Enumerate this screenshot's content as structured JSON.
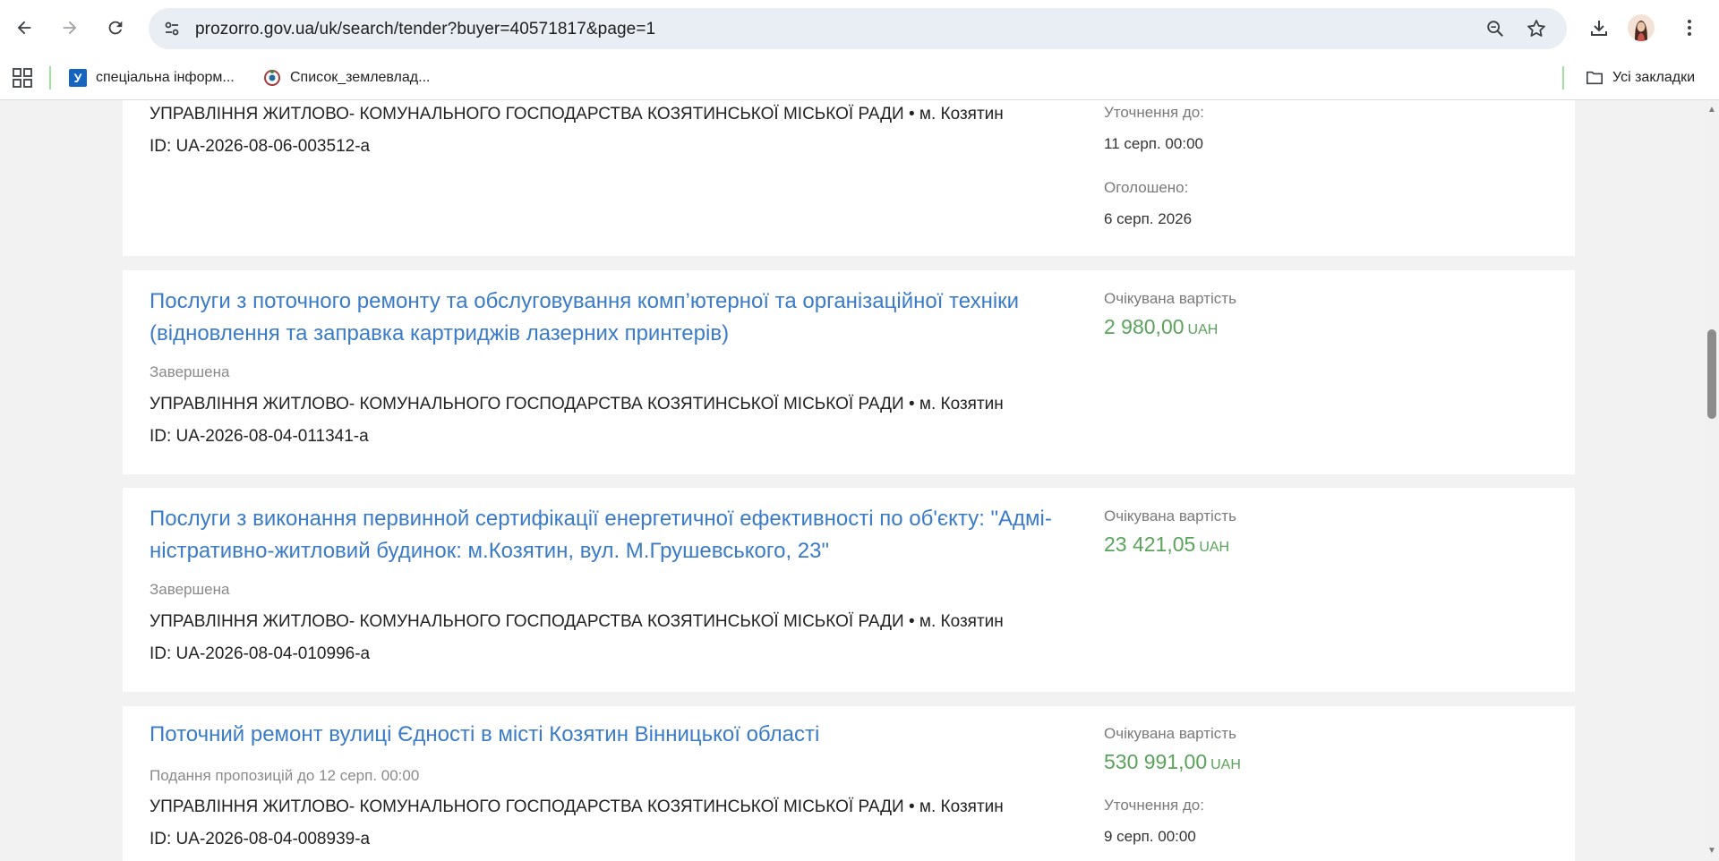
{
  "browser": {
    "url": "prozorro.gov.ua/uk/search/tender?buyer=40571817&page=1",
    "bookmarks": [
      {
        "label": "спеціальна інформ...",
        "icon": "u-favicon-icon",
        "favicon_text": "У"
      },
      {
        "label": "Список_землевлад...",
        "icon": "wikimedia-favicon-icon"
      }
    ],
    "all_bookmarks_label": "Усі закладки"
  },
  "tenders": [
    {
      "buyer": "УПРАВЛІННЯ ЖИТЛОВО- КОМУНАЛЬНОГО ГОСПОДАРСТВА КОЗЯТИНСЬКОЇ МІСЬКОЇ РАДИ • м. Козятин",
      "id": "ID: UA-2026-08-06-003512-a",
      "side": [
        {
          "label": "Уточнення до:",
          "value": "11 серп. 00:00"
        },
        {
          "label": "Оголошено:",
          "value": "6 серп. 2026"
        }
      ]
    },
    {
      "title": "Послуги з поточного ремонту та обслуговування комп’ютерної та організаційної техніки (відновлення та заправка картриджів лазерних принтерів)",
      "status": "Завершена",
      "buyer": "УПРАВЛІННЯ ЖИТЛОВО- КОМУНАЛЬНОГО ГОСПОДАРСТВА КОЗЯТИНСЬКОЇ МІСЬКОЇ РАДИ • м. Козятин",
      "id": "ID: UA-2026-08-04-011341-a",
      "price_label": "Очікувана вартість",
      "price": "2 980,00",
      "currency": "UAH"
    },
    {
      "title": "Послуги з виконання первинной сертифікації енергетичної ефективності по об'єкту: \"Адмі-ністративно-житловий будинок: м.Козятин, вул. М.Грушевського, 23\"",
      "status": "Завершена",
      "buyer": "УПРАВЛІННЯ ЖИТЛОВО- КОМУНАЛЬНОГО ГОСПОДАРСТВА КОЗЯТИНСЬКОЇ МІСЬКОЇ РАДИ • м. Козятин",
      "id": "ID: UA-2026-08-04-010996-a",
      "price_label": "Очікувана вартість",
      "price": "23 421,05",
      "currency": "UAH"
    },
    {
      "title": "Поточний ремонт вулиці Єдності в місті Козятин Вінницької області",
      "status": "Подання пропозицій до 12 серп. 00:00",
      "buyer": "УПРАВЛІННЯ ЖИТЛОВО- КОМУНАЛЬНОГО ГОСПОДАРСТВА КОЗЯТИНСЬКОЇ МІСЬКОЇ РАДИ • м. Козятин",
      "id": "ID: UA-2026-08-04-008939-a",
      "price_label": "Очікувана вартість",
      "price": "530 991,00",
      "currency": "UAH",
      "side": [
        {
          "label": "Уточнення до:",
          "value": "9 серп. 00:00"
        }
      ]
    }
  ],
  "colors": {
    "link": "#3a7bc8",
    "price": "#5aa35a",
    "background": "#f2f2f2"
  }
}
